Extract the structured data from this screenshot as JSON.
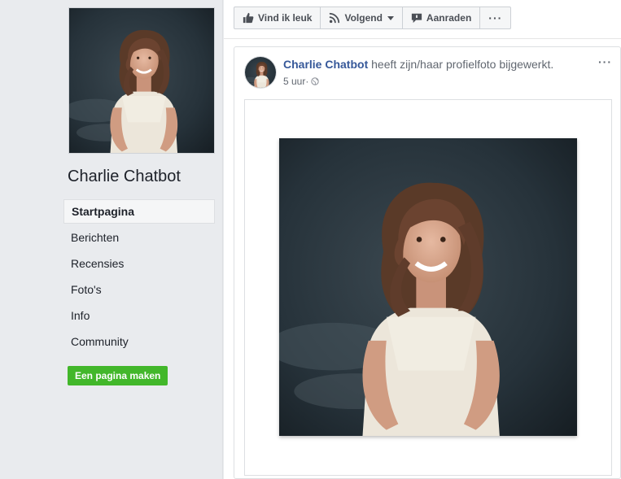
{
  "page": {
    "name": "Charlie Chatbot"
  },
  "nav": {
    "items": [
      {
        "label": "Startpagina",
        "active": true
      },
      {
        "label": "Berichten",
        "active": false
      },
      {
        "label": "Recensies",
        "active": false
      },
      {
        "label": "Foto's",
        "active": false
      },
      {
        "label": "Info",
        "active": false
      },
      {
        "label": "Community",
        "active": false
      }
    ],
    "create_page_label": "Een pagina maken"
  },
  "action_bar": {
    "like_label": "Vind ik leuk",
    "follow_label": "Volgend",
    "recommend_label": "Aanraden",
    "more_label": "···"
  },
  "post": {
    "author": "Charlie Chatbot",
    "action_text": " heeft zijn/haar profielfoto bijgewerkt.",
    "time": "5 uur",
    "separator": " · ",
    "menu_label": "···"
  },
  "icons": {
    "like": "thumbs-up-icon",
    "follow": "rss-icon",
    "recommend": "speech-bubble-icon",
    "privacy": "globe-icon"
  },
  "colors": {
    "link": "#365899",
    "create_button": "#42b72a",
    "background": "#e9ebee"
  }
}
